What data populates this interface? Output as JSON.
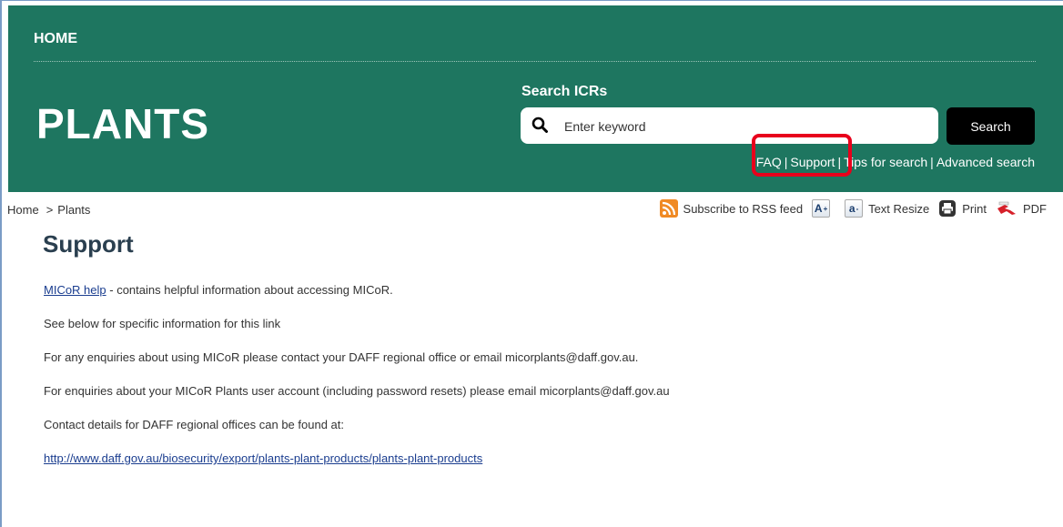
{
  "header": {
    "home_label": "HOME",
    "site_title": "PLANTS",
    "background_color": "#1e7660"
  },
  "search": {
    "heading": "Search ICRs",
    "placeholder": "Enter keyword",
    "button_label": "Search",
    "links": {
      "faq": "FAQ",
      "support": "Support",
      "tips": "Tips for search",
      "advanced": "Advanced search"
    }
  },
  "highlight": {
    "color": "#e8001c"
  },
  "breadcrumb": {
    "home": "Home",
    "separator": ">",
    "current": "Plants"
  },
  "toolbar": {
    "rss_label": "Subscribe to RSS feed",
    "increase_glyph": "A",
    "increase_sup": "+",
    "decrease_glyph": "a",
    "decrease_sup": "-",
    "resize_label": "Text Resize",
    "print_label": "Print",
    "pdf_label": "PDF",
    "rss_color": "#f08a24"
  },
  "page": {
    "title": "Support",
    "micor_help_link": "MICoR help",
    "micor_help_text": " - contains helpful information about accessing MICoR.",
    "p2": "See below for specific information for this link",
    "p3": "For any enquiries about using MICoR please contact your DAFF regional office or email  micorplants@daff.gov.au.",
    "p4": "For enquiries about your MICoR Plants user account (including password resets) please email  micorplants@daff.gov.au",
    "p5": "Contact details for DAFF regional offices can be found at:",
    "url_link": "http://www.daff.gov.au/biosecurity/export/plants-plant-products/plants-plant-products"
  }
}
